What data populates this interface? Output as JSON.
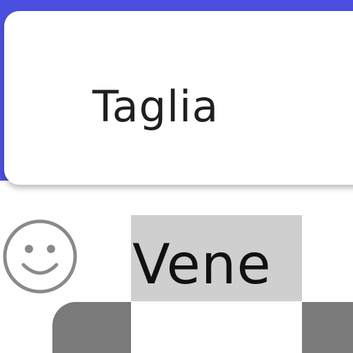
{
  "action_card": {
    "label": "Taglia"
  },
  "suggestion_bar": {
    "emoji_icon": "smiley-face-icon",
    "suggestion": "Vene"
  },
  "colors": {
    "accent": "#4b4fe0",
    "chip_bg": "#cfcfcf",
    "key_bg": "#7a7a7a"
  }
}
